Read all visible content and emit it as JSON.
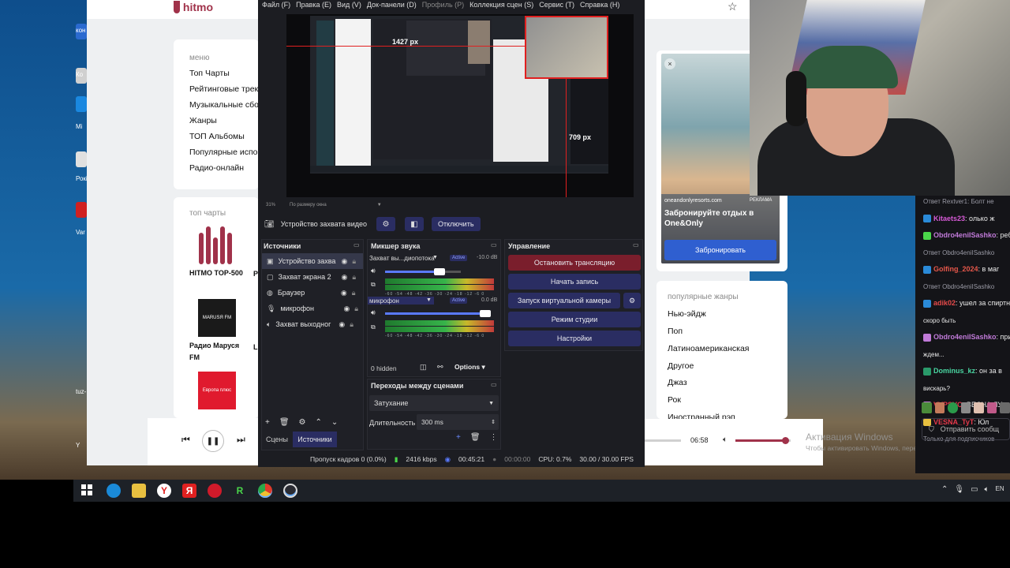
{
  "desktop": {
    "icons": [
      {
        "label": "кон"
      },
      {
        "label": "Ко"
      },
      {
        "label": "Mi"
      },
      {
        "label": "Рокі"
      },
      {
        "label": "Var"
      },
      {
        "label": "tuz-"
      },
      {
        "label": "Y"
      }
    ]
  },
  "hitmo": {
    "logo_text": "hitmo",
    "menu_title": "меню",
    "menu_items": [
      "Топ Чарты",
      "Рейтинговые трек",
      "Музыкальные сбо",
      "Жанры",
      "ТОП Альбомы",
      "Популярные испо",
      "Радио-онлайн"
    ],
    "top_charts_title": "топ чарты",
    "top_tile_label": "HITMO TOP-500",
    "radio1_label": "Радио Маруся",
    "radio1_sub": "FM",
    "radio1_tile": "MARUSЯ FM",
    "radio2_tile": "Европа плюс",
    "side_labels": [
      "Р",
      "L"
    ],
    "ad_site": "oneandonlyresorts.com",
    "ad_tag": "РЕКЛАМА",
    "ad_text": "Забронируйте отдых в One&Only",
    "ad_button": "Забронировать",
    "genres_title": "популярные жанры",
    "genres": [
      "Нью-эйдж",
      "Поп",
      "Латиноамериканская",
      "Другое",
      "Джаз",
      "Рок",
      "Иностранный рэп"
    ],
    "player_time": "06:58",
    "player_volume": 0.9,
    "activation_title": "Активация Windows",
    "activation_sub": "Чтобы активировать Windows, перейдите в раздел \"Параметры\""
  },
  "obs": {
    "menu": [
      "Файл (F)",
      "Правка (E)",
      "Вид (V)",
      "Док-панели (D)",
      "Профиль (P)",
      "Коллекция сцен (S)",
      "Сервис (T)",
      "Справка (H)"
    ],
    "preview": {
      "width_label": "1427 px",
      "height_label": "709 px",
      "zoom": "31%",
      "scale_mode": "По размеру окна"
    },
    "source_toolbar": {
      "source_name": "Устройство захвата видео",
      "disable_label": "Отключить"
    },
    "sources": {
      "title": "Источники",
      "items": [
        "Устройство захва",
        "Захват экрана 2",
        "Браузер",
        "микрофон",
        "Захват выходног"
      ]
    },
    "mixer": {
      "title": "Микшер звука",
      "channels": [
        {
          "name": "Захват вы...диопотока",
          "status": "Active",
          "db": "-10.0 dB",
          "volume": 0.72
        },
        {
          "name": "микрофон",
          "status": "Active",
          "db": "0.0 dB",
          "volume": 1.0
        }
      ],
      "ticks": "-60 -54 -48 -42 -36 -30 -24 -18 -12 -6 0",
      "hidden": "0 hidden",
      "options": "Options"
    },
    "controls": {
      "title": "Управление",
      "buttons": [
        "Остановить трансляцию",
        "Начать запись",
        "Запуск виртуальной камеры",
        "Режим студии",
        "Настройки"
      ]
    },
    "transitions": {
      "title": "Переходы между сценами",
      "selected": "Затухание",
      "duration_label": "Длительность",
      "duration_value": "300 ms"
    },
    "tabs": [
      "Сцены",
      "Источники"
    ],
    "status": {
      "dropped": "Пропуск кадров 0 (0.0%)",
      "bitrate": "2416 kbps",
      "live_time": "00:45:21",
      "rec_time": "00:00:00",
      "cpu": "CPU: 0.7%",
      "fps": "30.00 / 30.00 FPS"
    }
  },
  "chat": {
    "lines": [
      {
        "user": "",
        "text": "Ответ Rextver1: Болт не",
        "color": "#9a9aa5"
      },
      {
        "user": "Kitaets23",
        "text": ": олько ж",
        "color": "#d65ad6"
      },
      {
        "user": "Obdro4eniISashko",
        "text": ": ребя",
        "color": "#c07ad8"
      },
      {
        "user": "",
        "text": "Ответ Obdro4eniISashko",
        "color": "#9a9aa5"
      },
      {
        "user": "Golfing_2024",
        "text": ": в маг",
        "color": "#e6574a"
      },
      {
        "user": "",
        "text": "Ответ Obdro4eniISashko",
        "color": "#9a9aa5"
      },
      {
        "user": "adik02",
        "text": ": ушел за спиртн",
        "color": "#e64a4a"
      },
      {
        "user": "",
        "text": "скоро быть",
        "color": "#e8e8e8"
      },
      {
        "user": "Obdro4eniISashko",
        "text": ": при",
        "color": "#c07ad8"
      },
      {
        "user": "",
        "text": "ждем...",
        "color": "#e8e8e8"
      },
      {
        "user": "Dominus_kz",
        "text": ": он за в",
        "color": "#4ad6a2"
      },
      {
        "user": "",
        "text": "вискарь?",
        "color": "#e8e8e8"
      },
      {
        "user": "VVPSVO",
        "text": ": ВЕСНА ЛУ",
        "color": "#e6394a"
      },
      {
        "user": "VESNA_TyT",
        "text": ": Юл",
        "color": "#e6394a"
      },
      {
        "user": "",
        "text": "Только для подписчиков",
        "color": "#9a9aa5"
      }
    ],
    "send_label": "Отправить сообщ"
  },
  "taskbar": {
    "apps": [
      "edge",
      "files",
      "yandex-browser",
      "yandex",
      "opera",
      "green-app",
      "chrome",
      "obs"
    ],
    "tray_lang": "EN"
  }
}
